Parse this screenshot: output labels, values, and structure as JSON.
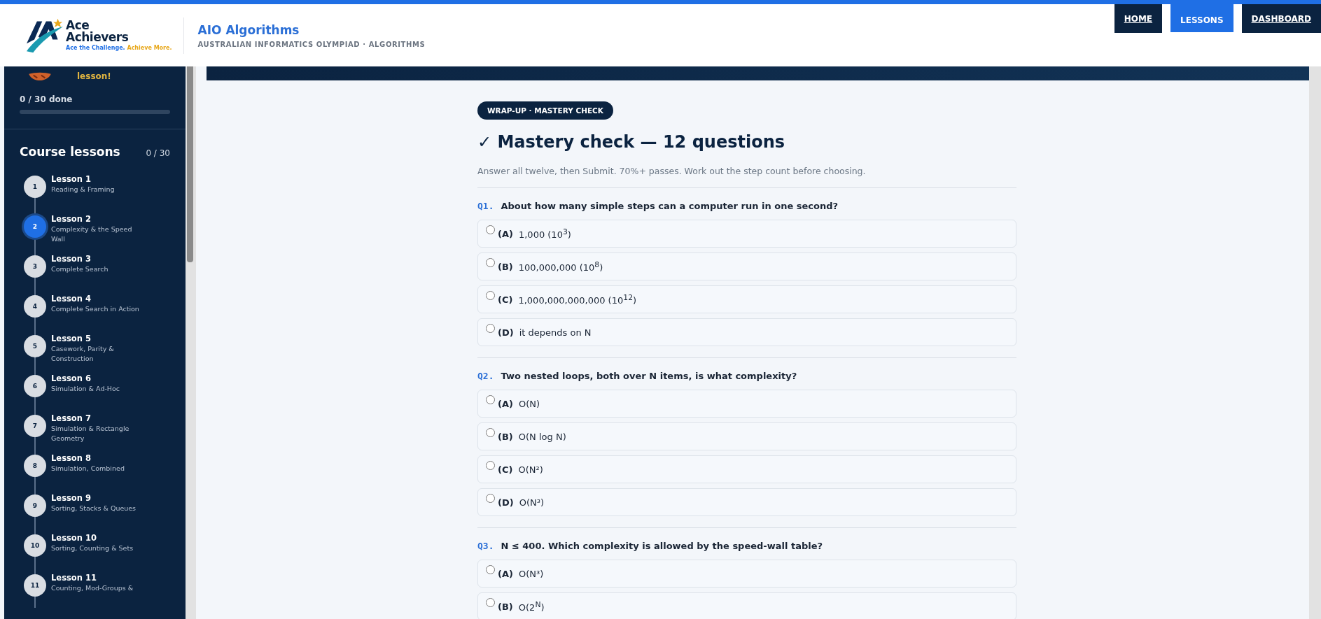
{
  "header": {
    "logo": {
      "line1": "Ace",
      "line2": "Achievers",
      "tagline": [
        "Ace the Challenge.",
        "Achieve More."
      ]
    },
    "title": "AIO Algorithms",
    "subtitle": "AUSTRALIAN INFORMATICS OLYMPIAD · ALGORITHMS"
  },
  "nav": [
    {
      "label": "HOME",
      "selected": false
    },
    {
      "label": "LESSONS",
      "selected": true
    },
    {
      "label": "DASHBOARD",
      "selected": false
    }
  ],
  "sidebar": {
    "greeting": "lesson!",
    "progress_text": "0 / 30 done",
    "progress": {
      "level": 0
    },
    "heading": "Course lessons",
    "count": "0 / 30",
    "lessons": [
      {
        "number": "1",
        "title": "Lesson 1",
        "subtitle": "Reading & Framing",
        "selected": false
      },
      {
        "number": "2",
        "title": "Lesson 2",
        "subtitle": "Complexity & the Speed Wall",
        "selected": true
      },
      {
        "number": "3",
        "title": "Lesson 3",
        "subtitle": "Complete Search",
        "selected": false
      },
      {
        "number": "4",
        "title": "Lesson 4",
        "subtitle": "Complete Search in Action",
        "selected": false
      },
      {
        "number": "5",
        "title": "Lesson 5",
        "subtitle": "Casework, Parity & Construction",
        "selected": false
      },
      {
        "number": "6",
        "title": "Lesson 6",
        "subtitle": "Simulation & Ad-Hoc",
        "selected": false
      },
      {
        "number": "7",
        "title": "Lesson 7",
        "subtitle": "Simulation & Rectangle Geometry",
        "selected": false
      },
      {
        "number": "8",
        "title": "Lesson 8",
        "subtitle": "Simulation, Combined",
        "selected": false
      },
      {
        "number": "9",
        "title": "Lesson 9",
        "subtitle": "Sorting, Stacks & Queues",
        "selected": false
      },
      {
        "number": "10",
        "title": "Lesson 10",
        "subtitle": "Sorting, Counting & Sets",
        "selected": false
      },
      {
        "number": "11",
        "title": "Lesson 11",
        "subtitle": "Counting, Mod-Groups &",
        "selected": false
      }
    ]
  },
  "quiz": {
    "tag": "WRAP-UP · MASTERY CHECK",
    "title": "✓ Mastery check — 12 questions",
    "description": "Answer all twelve, then Submit. 70%+ passes. Work out the step count before choosing.",
    "questions": [
      {
        "number": "Q1.",
        "text": "About how many simple steps can a computer run in one second?",
        "options": [
          {
            "letter": "(A)",
            "text": "1,000 (10$^{3}$)",
            "checked": false
          },
          {
            "letter": "(B)",
            "text": "100,000,000 (10$^{8}$)",
            "checked": false
          },
          {
            "letter": "(C)",
            "text": "1,000,000,000,000 (10$^{12}$)",
            "checked": false
          },
          {
            "letter": "(D)",
            "text": "it depends on N",
            "checked": false
          }
        ]
      },
      {
        "number": "Q2.",
        "text": "Two nested loops, both over N items, is what complexity?",
        "options": [
          {
            "letter": "(A)",
            "text": "O(N)",
            "checked": false
          },
          {
            "letter": "(B)",
            "text": "O(N log N)",
            "checked": false
          },
          {
            "letter": "(C)",
            "text": "O(N²)",
            "checked": false
          },
          {
            "letter": "(D)",
            "text": "O(N³)",
            "checked": false
          }
        ]
      },
      {
        "number": "Q3.",
        "text": "N ≤ 400. Which complexity is allowed by the speed-wall table?",
        "options": [
          {
            "letter": "(A)",
            "text": "O(N³)",
            "checked": false
          },
          {
            "letter": "(B)",
            "text": "O(2$^{N}$)",
            "checked": false
          }
        ]
      }
    ]
  }
}
